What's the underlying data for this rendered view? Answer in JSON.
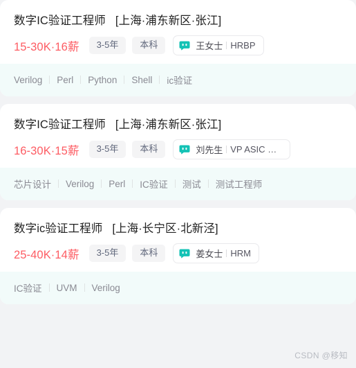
{
  "page": {
    "background_color": "#f2f3f5",
    "card_background": "#ffffff",
    "skill_row_background": "#f2fbfa",
    "salary_color": "#fd5c63",
    "chat_icon_color": "#13c2b5"
  },
  "watermark": {
    "text": "CSDN @移知"
  },
  "jobs": [
    {
      "title": "数字IC验证工程师",
      "location": "[上海·浦东新区·张江]",
      "salary": "15-30K·16薪",
      "experience": "3-5年",
      "education": "本科",
      "hr": {
        "icon": "chat-bubble-icon",
        "name": "王女士",
        "title": "HRBP"
      },
      "skills": [
        "Verilog",
        "Perl",
        "Python",
        "Shell",
        "ic验证"
      ]
    },
    {
      "title": "数字IC验证工程师",
      "location": "[上海·浦东新区·张江]",
      "salary": "16-30K·15薪",
      "experience": "3-5年",
      "education": "本科",
      "hr": {
        "icon": "chat-bubble-icon",
        "name": "刘先生",
        "title": "VP ASIC Des…"
      },
      "skills": [
        "芯片设计",
        "Verilog",
        "Perl",
        "IC验证",
        "测试",
        "测试工程师"
      ]
    },
    {
      "title": "数字ic验证工程师",
      "location": "[上海·长宁区·北新泾]",
      "salary": "25-40K·14薪",
      "experience": "3-5年",
      "education": "本科",
      "hr": {
        "icon": "chat-bubble-icon",
        "name": "姜女士",
        "title": "HRM"
      },
      "skills": [
        "IC验证",
        "UVM",
        "Verilog"
      ]
    }
  ]
}
